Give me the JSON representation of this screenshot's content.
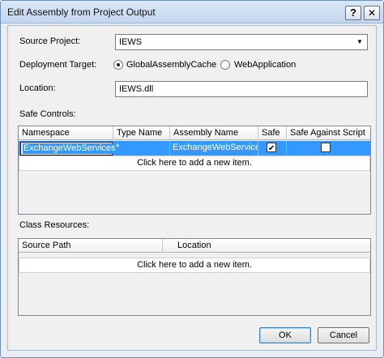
{
  "window": {
    "title": "Edit Assembly from Project Output",
    "help_label": "?",
    "close_label": "✕"
  },
  "source_project": {
    "label": "Source Project:",
    "value": "IEWS",
    "arrow": "▼"
  },
  "deployment_target": {
    "label": "Deployment Target:",
    "options": [
      {
        "label": "GlobalAssemblyCache",
        "checked": true
      },
      {
        "label": "WebApplication",
        "checked": false
      }
    ]
  },
  "location": {
    "label": "Location:",
    "value": "IEWS.dll"
  },
  "safe_controls": {
    "label": "Safe Controls:",
    "columns": [
      "Namespace",
      "Type Name",
      "Assembly Name",
      "Safe",
      "Safe Against Script"
    ],
    "rows": [
      {
        "namespace": "ExchangeWebServices",
        "type_name": "*",
        "assembly_name": "ExchangeWebServices",
        "safe": true,
        "safe_against_script": false
      }
    ],
    "add_item": "Click here to add a new item."
  },
  "class_resources": {
    "label": "Class Resources:",
    "columns": [
      "Source Path",
      "Location"
    ],
    "add_item": "Click here to add a new item."
  },
  "buttons": {
    "ok": "OK",
    "cancel": "Cancel"
  }
}
